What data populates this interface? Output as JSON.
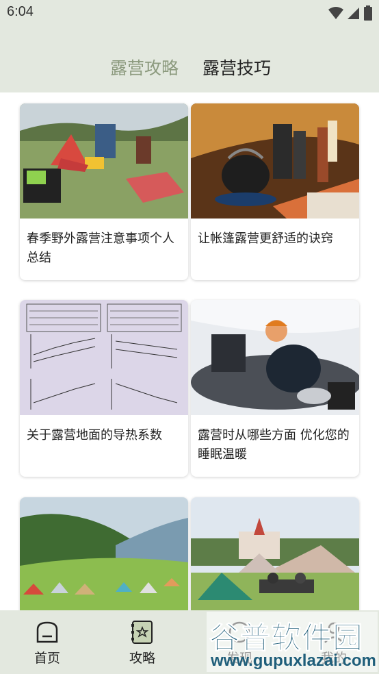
{
  "status_bar": {
    "time": "6:04"
  },
  "tabs": [
    {
      "label": "露营攻略",
      "active": false
    },
    {
      "label": "露营技巧",
      "active": true
    }
  ],
  "cards": [
    {
      "title": "春季野外露营注意事项个人总结",
      "image": "campsite-tent-grass-photo"
    },
    {
      "title": "让帐篷露营更舒适的诀窍",
      "image": "kettle-stove-tent-photo"
    },
    {
      "title": "关于露营地面的导热系数",
      "image": "thermal-conductivity-chart-photo"
    },
    {
      "title": "露营时从哪些方面 优化您的睡眠温暖",
      "image": "sleeping-bag-snow-photo"
    },
    {
      "title": "",
      "image": "hillside-campground-photo"
    },
    {
      "title": "",
      "image": "lawn-tents-photo"
    }
  ],
  "nav": [
    {
      "label": "首页",
      "icon": "home-icon"
    },
    {
      "label": "攻略",
      "icon": "guide-book-icon"
    },
    {
      "label": "发现",
      "icon": "discover-icon"
    },
    {
      "label": "我的",
      "icon": "profile-icon"
    }
  ],
  "watermark": {
    "text": "谷普软件园",
    "url": "www.gupuxlazai.com"
  },
  "colors": {
    "header_bg": "#e3e8df",
    "inactive_tab": "#8c9a7e",
    "active_tab": "#222222"
  }
}
